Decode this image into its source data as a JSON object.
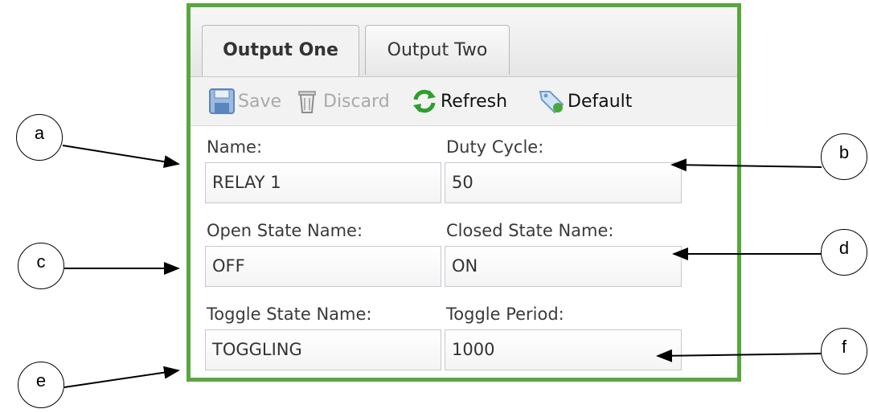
{
  "tabs": [
    {
      "label": "Output One",
      "active": true
    },
    {
      "label": "Output Two",
      "active": false
    }
  ],
  "toolbar": {
    "save_label": "Save",
    "discard_label": "Discard",
    "refresh_label": "Refresh",
    "default_label": "Default",
    "save_icon": "floppy-disk-icon",
    "discard_icon": "trash-icon",
    "refresh_icon": "refresh-arrows-icon",
    "default_icon": "tag-icon"
  },
  "fields": {
    "name": {
      "label": "Name:",
      "value": "RELAY 1"
    },
    "duty_cycle": {
      "label": "Duty Cycle:",
      "value": "50"
    },
    "open_state_name": {
      "label": "Open State Name:",
      "value": "OFF"
    },
    "closed_state_name": {
      "label": "Closed State Name:",
      "value": "ON"
    },
    "toggle_state_name": {
      "label": "Toggle State Name:",
      "value": "TOGGLING"
    },
    "toggle_period": {
      "label": "Toggle Period:",
      "value": "1000"
    }
  },
  "callouts": {
    "a": "a",
    "b": "b",
    "c": "c",
    "d": "d",
    "e": "e",
    "f": "f"
  },
  "colors": {
    "panel_border": "#5aa63f",
    "refresh_icon": "#2e9e2e",
    "save_icon": "#3a78c2"
  }
}
